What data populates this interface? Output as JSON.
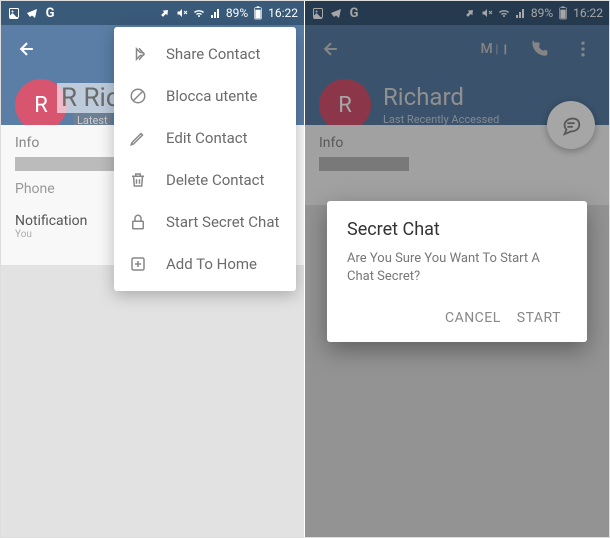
{
  "statusbar": {
    "left_icons": [
      "image-icon",
      "telegram-icon",
      "g-icon"
    ],
    "network": "signal",
    "battery_pct": "89%",
    "time": "16:22"
  },
  "left": {
    "contact_letter": "R",
    "contact_name": "Ricca",
    "latest_label": "Latest",
    "info_label": "Info",
    "phone_label": "Phone",
    "notif_label": "Notification",
    "notif_sub": "You",
    "menu": {
      "share": "Share Contact",
      "block": "Blocca utente",
      "edit": "Edit Contact",
      "delete": "Delete Contact",
      "secret": "Start Secret Chat",
      "home": "Add To Home"
    }
  },
  "right": {
    "avatar_letter": "R",
    "contact_name": "Richard",
    "contact_sub": "Last Recently Accessed",
    "action_label": "M",
    "info_label": "Info",
    "dialog": {
      "title": "Secret Chat",
      "text": "Are You Sure You Want To Start A Chat Secret?",
      "cancel": "CANCEL",
      "start": "START"
    }
  }
}
